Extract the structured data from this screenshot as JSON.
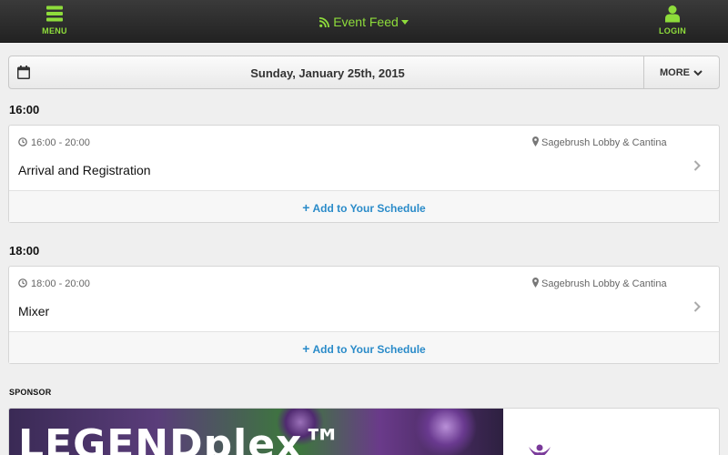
{
  "header": {
    "menu_label": "MENU",
    "title": "Event Feed",
    "login_label": "LOGIN",
    "menu_icon": "hamburger-icon",
    "feed_icon": "rss-icon",
    "login_icon": "user-icon",
    "accent_color": "#8edc3b"
  },
  "datebar": {
    "date": "Sunday, January 25th, 2015",
    "more_label": "MORE"
  },
  "groups": [
    {
      "time": "16:00",
      "event": {
        "time_range": "16:00 - 20:00",
        "location": "Sagebrush Lobby & Cantina",
        "title": "Arrival and Registration",
        "add_label": "Add to Your Schedule"
      }
    },
    {
      "time": "18:00",
      "event": {
        "time_range": "18:00 - 20:00",
        "location": "Sagebrush Lobby & Cantina",
        "title": "Mixer",
        "add_label": "Add to Your Schedule"
      }
    }
  ],
  "sponsor": {
    "header": "SPONSOR",
    "banner_text": "LEGENDplex™"
  }
}
